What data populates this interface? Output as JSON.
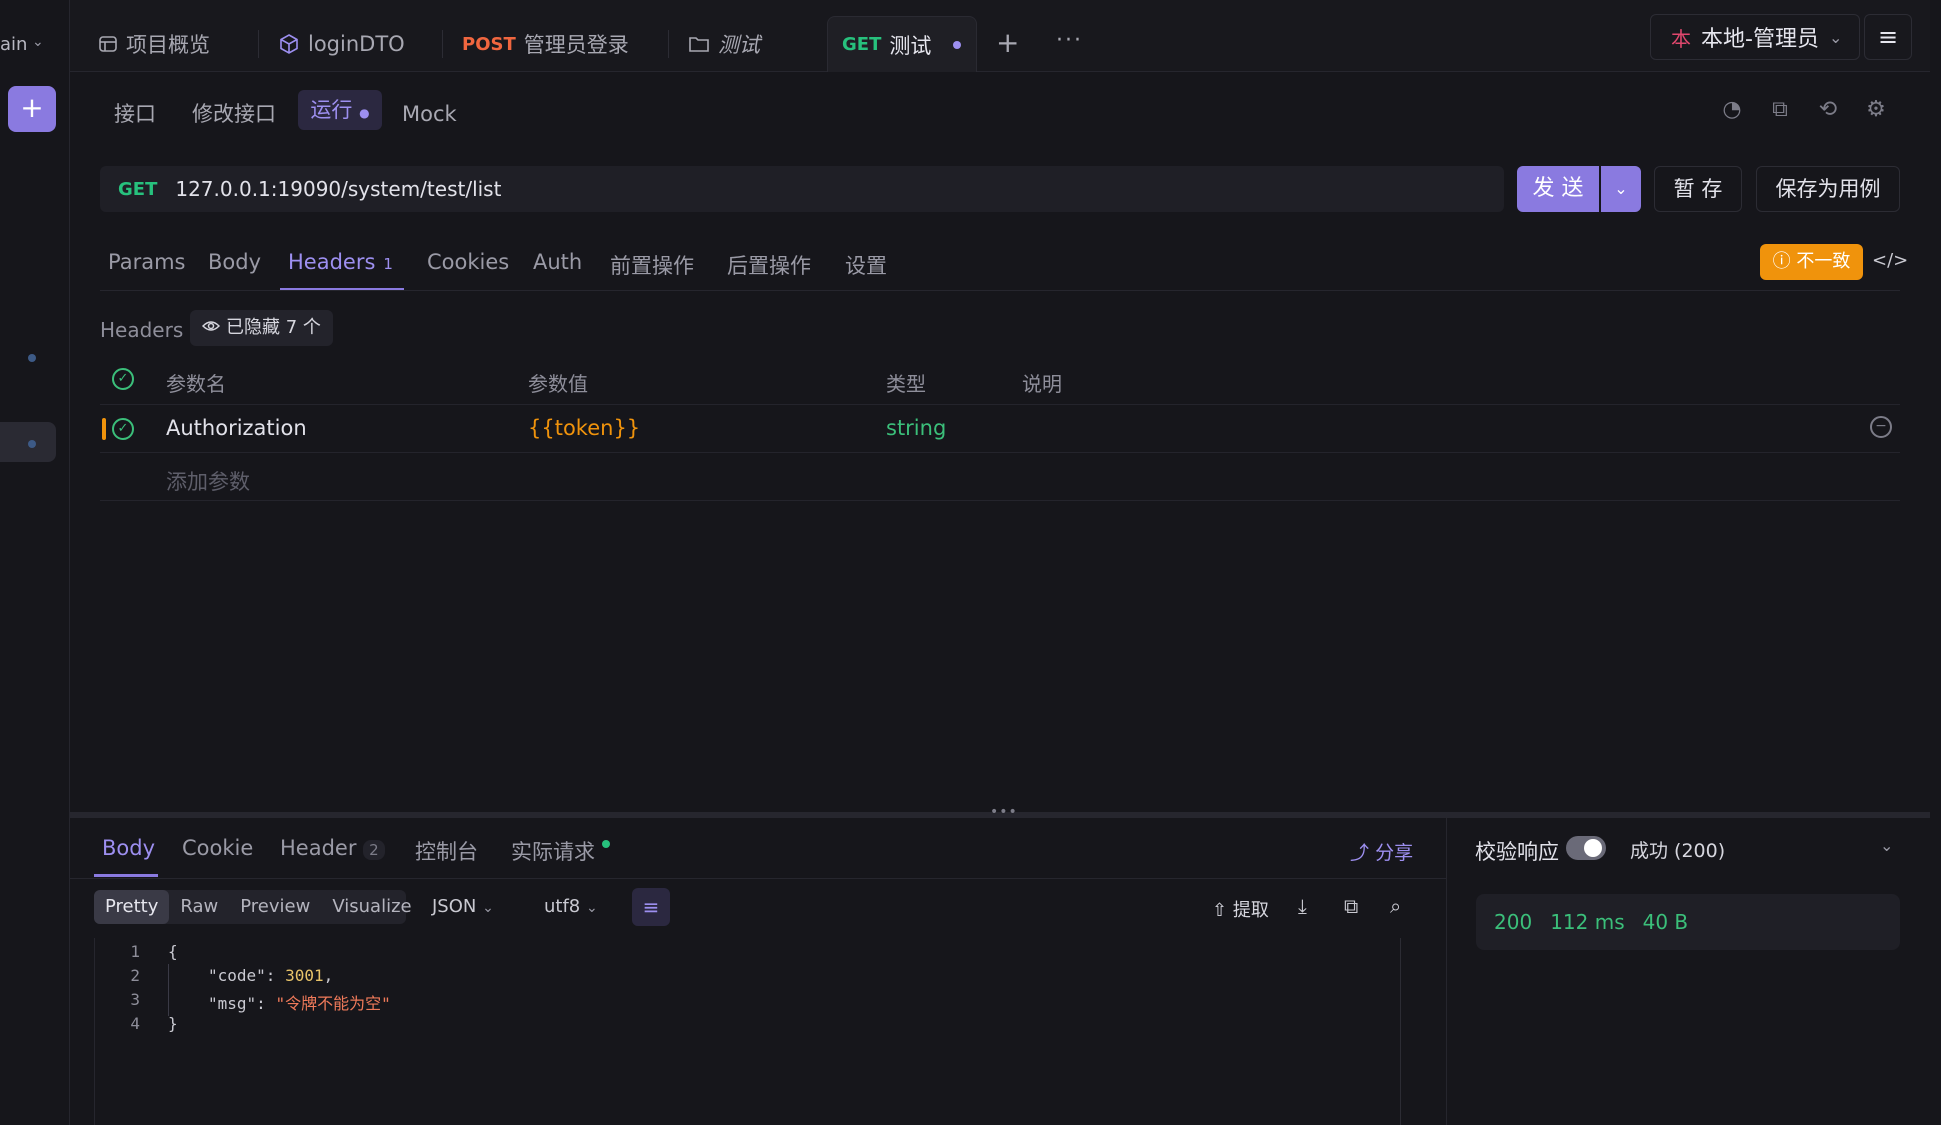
{
  "sidebar": {
    "branch": "ain",
    "add_label": "+"
  },
  "tabs": {
    "overview": "项目概览",
    "login_dto": "loginDTO",
    "post_method": "POST",
    "post_title": "管理员登录",
    "folder_title": "测试",
    "get_method": "GET",
    "get_title": "测试",
    "add": "+",
    "more": "···"
  },
  "env": {
    "mark": "本",
    "name": "本地-管理员"
  },
  "subtabs": {
    "api": "接口",
    "edit": "修改接口",
    "run": "运行",
    "mock": "Mock"
  },
  "request": {
    "method": "GET",
    "url": "127.0.0.1:19090/system/test/list",
    "send": "发 送",
    "save_temp": "暂 存",
    "save_case": "保存为用例"
  },
  "req_tabs": {
    "params": "Params",
    "body": "Body",
    "headers": "Headers",
    "headers_count": "1",
    "cookies": "Cookies",
    "auth": "Auth",
    "pre": "前置操作",
    "post": "后置操作",
    "settings": "设置",
    "inconsistent": "不一致"
  },
  "headers": {
    "label": "Headers",
    "hidden": "已隐藏 7 个",
    "col_name": "参数名",
    "col_value": "参数值",
    "col_type": "类型",
    "col_desc": "说明",
    "rows": [
      {
        "name": "Authorization",
        "value": "{{token}}",
        "type": "string"
      }
    ],
    "add_placeholder": "添加参数"
  },
  "response": {
    "tabs": {
      "body": "Body",
      "cookie": "Cookie",
      "header": "Header",
      "header_count": "2",
      "console": "控制台",
      "actual": "实际请求"
    },
    "share": "分享",
    "formats": [
      "Pretty",
      "Raw",
      "Preview",
      "Visualize"
    ],
    "lang": "JSON",
    "encoding": "utf8",
    "extract": "提取",
    "code_lines": [
      "1",
      "2",
      "3",
      "4"
    ],
    "code": {
      "open": "{",
      "key1": "\"code\"",
      "val1": "3001",
      "key2": "\"msg\"",
      "val2": "\"令牌不能为空\"",
      "close": "}"
    }
  },
  "validation": {
    "label": "校验响应",
    "result": "成功 (200)",
    "status": "200",
    "time": "112 ms",
    "size": "40 B"
  },
  "colors": {
    "accent": "#8a7ae0",
    "get": "#27c17d",
    "post": "#f0663f",
    "warning": "#f0930c"
  }
}
